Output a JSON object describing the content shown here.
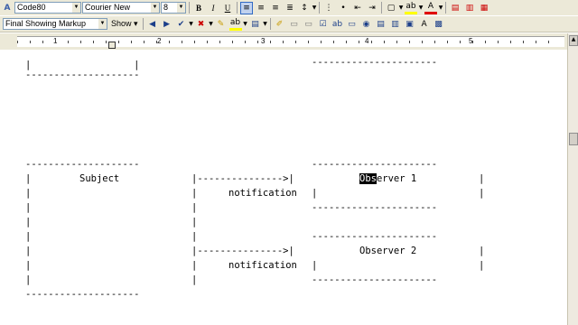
{
  "toolbar1": {
    "style_value": "Code80",
    "font_value": "Courier New",
    "size_value": "8",
    "bold_label": "B",
    "italic_label": "I",
    "underline_label": "U"
  },
  "toolbar2": {
    "markup_value": "Final Showing Markup",
    "show_label": "Show"
  },
  "ruler": {
    "numbers": [
      "1",
      "2",
      "3",
      "4",
      "5"
    ]
  },
  "document": {
    "lines": [
      {
        "a": "   |                  |",
        "b": "",
        "c": ""
      },
      {
        "a": "   --------------------",
        "b": "",
        "c": ""
      },
      {
        "a": "   --------------------",
        "b": "",
        "c": "----------------------"
      },
      {
        "a": "   |      Subject     |--------------->|",
        "b": "",
        "c": "ver 1            |"
      },
      {
        "a": "   |                  |   notification |",
        "b": "",
        "c": ""
      },
      {
        "a": "   |                  |",
        "b": "",
        "c": ""
      },
      {
        "a": "   |                  |",
        "b": "",
        "c": ""
      }
    ],
    "top_bar_right": "----------------------",
    "subject_label": "Subject",
    "notification_1": "notification",
    "notification_2": "notification",
    "observer1_selected": "Obs",
    "observer1_rest": "erver 1",
    "observer2_label": "Observer 2"
  }
}
